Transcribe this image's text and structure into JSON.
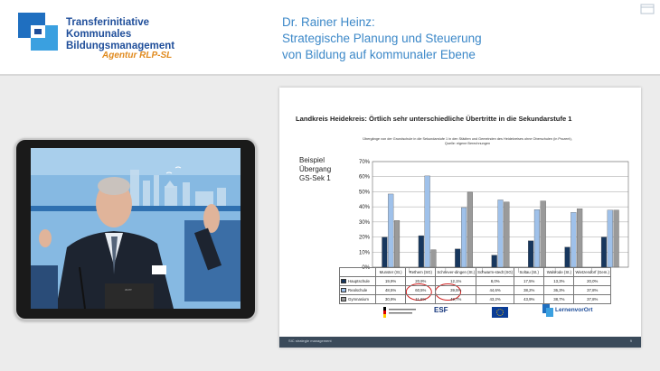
{
  "header": {
    "logo_line1": "Transferinitiative",
    "logo_line2": "Kommunales",
    "logo_line3": "Bildungsmanagement",
    "agency": "Agentur RLP-SL",
    "talk_title_line1": "Dr. Rainer Heinz:",
    "talk_title_line2": "Strategische Planung und Steuerung",
    "talk_title_line3": "von Bildung auf kommunaler Ebene"
  },
  "slide": {
    "title": "Landkreis Heidekreis: Örtlich sehr unterschiedliche Übertritte in die Sekundarstufe 1",
    "subtitle_line1": "Übergänge von der Grundschule in die Sekundarstufe 1 in den Städten und Gemeinden des Heidekreises ohne Oberschulen (in Prozent),",
    "subtitle_line2": "Quelle: eigene Berechnungen",
    "side_label_line1": "Beispiel",
    "side_label_line2": "Übergang",
    "side_label_line3": "GS-Sek 1",
    "logo_esf": "ESF",
    "logo_lernen": "LernenvorOrt",
    "footer_text": "SIC strategie management",
    "footer_page": "9"
  },
  "colors": {
    "hauptschule": "#17375e",
    "realschule": "#9fc1ea",
    "gymnasium": "#9a9a9a",
    "highlight": "#d02020",
    "logo_blue": "#1f4e9a",
    "title_blue": "#3c88c8"
  },
  "chart_data": {
    "type": "bar",
    "categories": [
      "Munster (St.)",
      "Rethem (SG)",
      "Schnever-dingen (St.)",
      "Schwarm-stedt (SG)",
      "Soltau (St.)",
      "Walsrode (St.)",
      "Wietzendorf (Gem.)"
    ],
    "series": [
      {
        "name": "Hauptschule",
        "values": [
          19.9,
          20.9,
          12.1,
          8.0,
          17.5,
          13.3,
          20.0
        ],
        "labels": [
          "19,9%",
          "20,9%",
          "12,1%",
          "8,0%",
          "17,5%",
          "13,3%",
          "20,0%"
        ]
      },
      {
        "name": "Realschule",
        "values": [
          48.5,
          60.5,
          39.5,
          44.6,
          38.2,
          36.3,
          37.8
        ],
        "labels": [
          "48,5%",
          "60,5%",
          "39,5%",
          "44,6%",
          "38,2%",
          "36,3%",
          "37,8%"
        ]
      },
      {
        "name": "Gymnasium",
        "values": [
          30.9,
          11.6,
          49.7,
          43.2,
          43.9,
          38.7,
          37.8
        ],
        "labels": [
          "30,9%",
          "11,6%",
          "49,7%",
          "43,2%",
          "43,9%",
          "38,7%",
          "37,8%"
        ]
      }
    ],
    "y_ticks": [
      "0%",
      "10%",
      "20%",
      "30%",
      "40%",
      "50%",
      "60%",
      "70%"
    ],
    "ylim": [
      0,
      70
    ],
    "grid": true,
    "legend": "table-below"
  }
}
